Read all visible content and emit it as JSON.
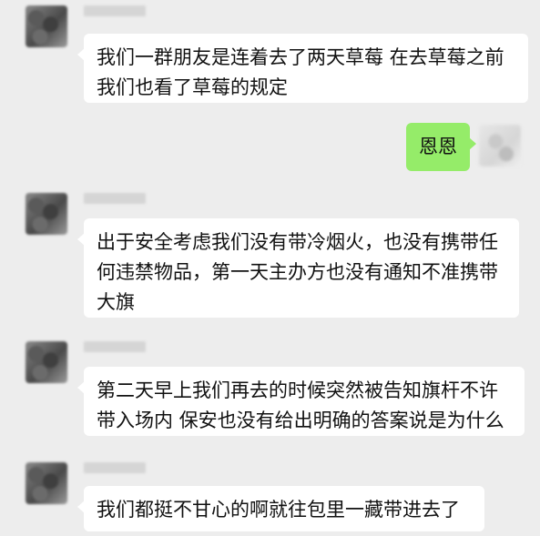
{
  "chat": {
    "messages": [
      {
        "side": "left",
        "lines": [
          "我们一群朋友是连着去了两天草莓 在去草莓之前",
          "我们也看了草莓的规定"
        ]
      },
      {
        "side": "right",
        "lines": [
          "恩恩"
        ]
      },
      {
        "side": "left",
        "lines": [
          "出于安全考虑我们没有带冷烟火，也没有携带任",
          "何违禁物品，第一天主办方也没有通知不准携带",
          "大旗"
        ]
      },
      {
        "side": "left",
        "lines": [
          "第二天早上我们再去的时候突然被告知旗杆不许",
          "带入场内 保安也没有给出明确的答案说是为什么"
        ]
      },
      {
        "side": "left",
        "lines": [
          "我们都挺不甘心的啊就往包里一藏带进去了"
        ]
      }
    ]
  },
  "colors": {
    "background": "#ededed",
    "incoming_bubble": "#ffffff",
    "outgoing_bubble": "#95ec69"
  }
}
